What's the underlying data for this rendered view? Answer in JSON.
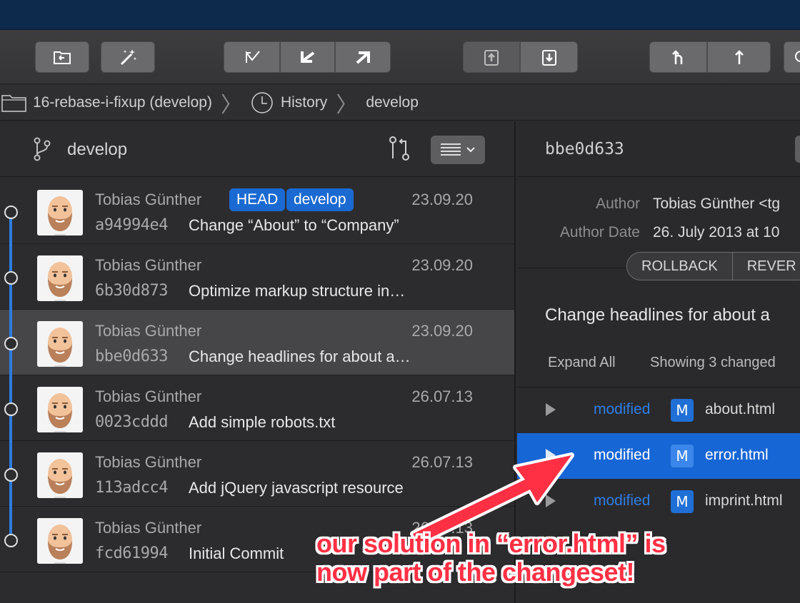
{
  "toolbar": {
    "buttons": [
      "open-repo-icon",
      "wand-icon",
      "undo-icon",
      "fetch-left-icon",
      "fetch-right-icon",
      "stash-up-icon",
      "stash-down-icon",
      "branch-icon",
      "push-icon",
      "search-icon"
    ]
  },
  "breadcrumb": {
    "repo": "16-rebase-i-fixup (develop)",
    "view": "History",
    "branch": "develop"
  },
  "left_panel": {
    "branch": "develop"
  },
  "commits": [
    {
      "author": "Tobias Günther",
      "date": "23.09.20",
      "hash": "a94994e4",
      "message": "Change “About” to “Company”",
      "tags": [
        "HEAD",
        "develop"
      ]
    },
    {
      "author": "Tobias Günther",
      "date": "23.09.20",
      "hash": "6b30d873",
      "message": "Optimize markup structure in…",
      "tags": []
    },
    {
      "author": "Tobias Günther",
      "date": "23.09.20",
      "hash": "bbe0d633",
      "message": "Change headlines for about a…",
      "tags": [],
      "selected": true
    },
    {
      "author": "Tobias Günther",
      "date": "26.07.13",
      "hash": "0023cddd",
      "message": "Add simple robots.txt",
      "tags": []
    },
    {
      "author": "Tobias Günther",
      "date": "26.07.13",
      "hash": "113adcc4",
      "message": "Add jQuery javascript resource",
      "tags": []
    },
    {
      "author": "Tobias Günther",
      "date": "26.07.13",
      "hash": "fcd61994",
      "message": "Initial Commit",
      "tags": []
    }
  ],
  "detail": {
    "hash": "bbe0d633",
    "author_label": "Author",
    "author_value": "Tobias Günther <tg",
    "date_label": "Author Date",
    "date_value": "26. July 2013 at 10",
    "rollback": "ROLLBACK",
    "revert": "REVER",
    "subject": "Change headlines for about a",
    "expand_all": "Expand All",
    "showing": "Showing 3 changed",
    "files": [
      {
        "status": "modified",
        "badge": "M",
        "name": "about.html"
      },
      {
        "status": "modified",
        "badge": "M",
        "name": "error.html",
        "selected": true
      },
      {
        "status": "modified",
        "badge": "M",
        "name": "imprint.html"
      }
    ]
  },
  "annotation": {
    "line1": "our solution in “error.html” is",
    "line2": "now part of the changeset!",
    "color": "#ff3044"
  }
}
